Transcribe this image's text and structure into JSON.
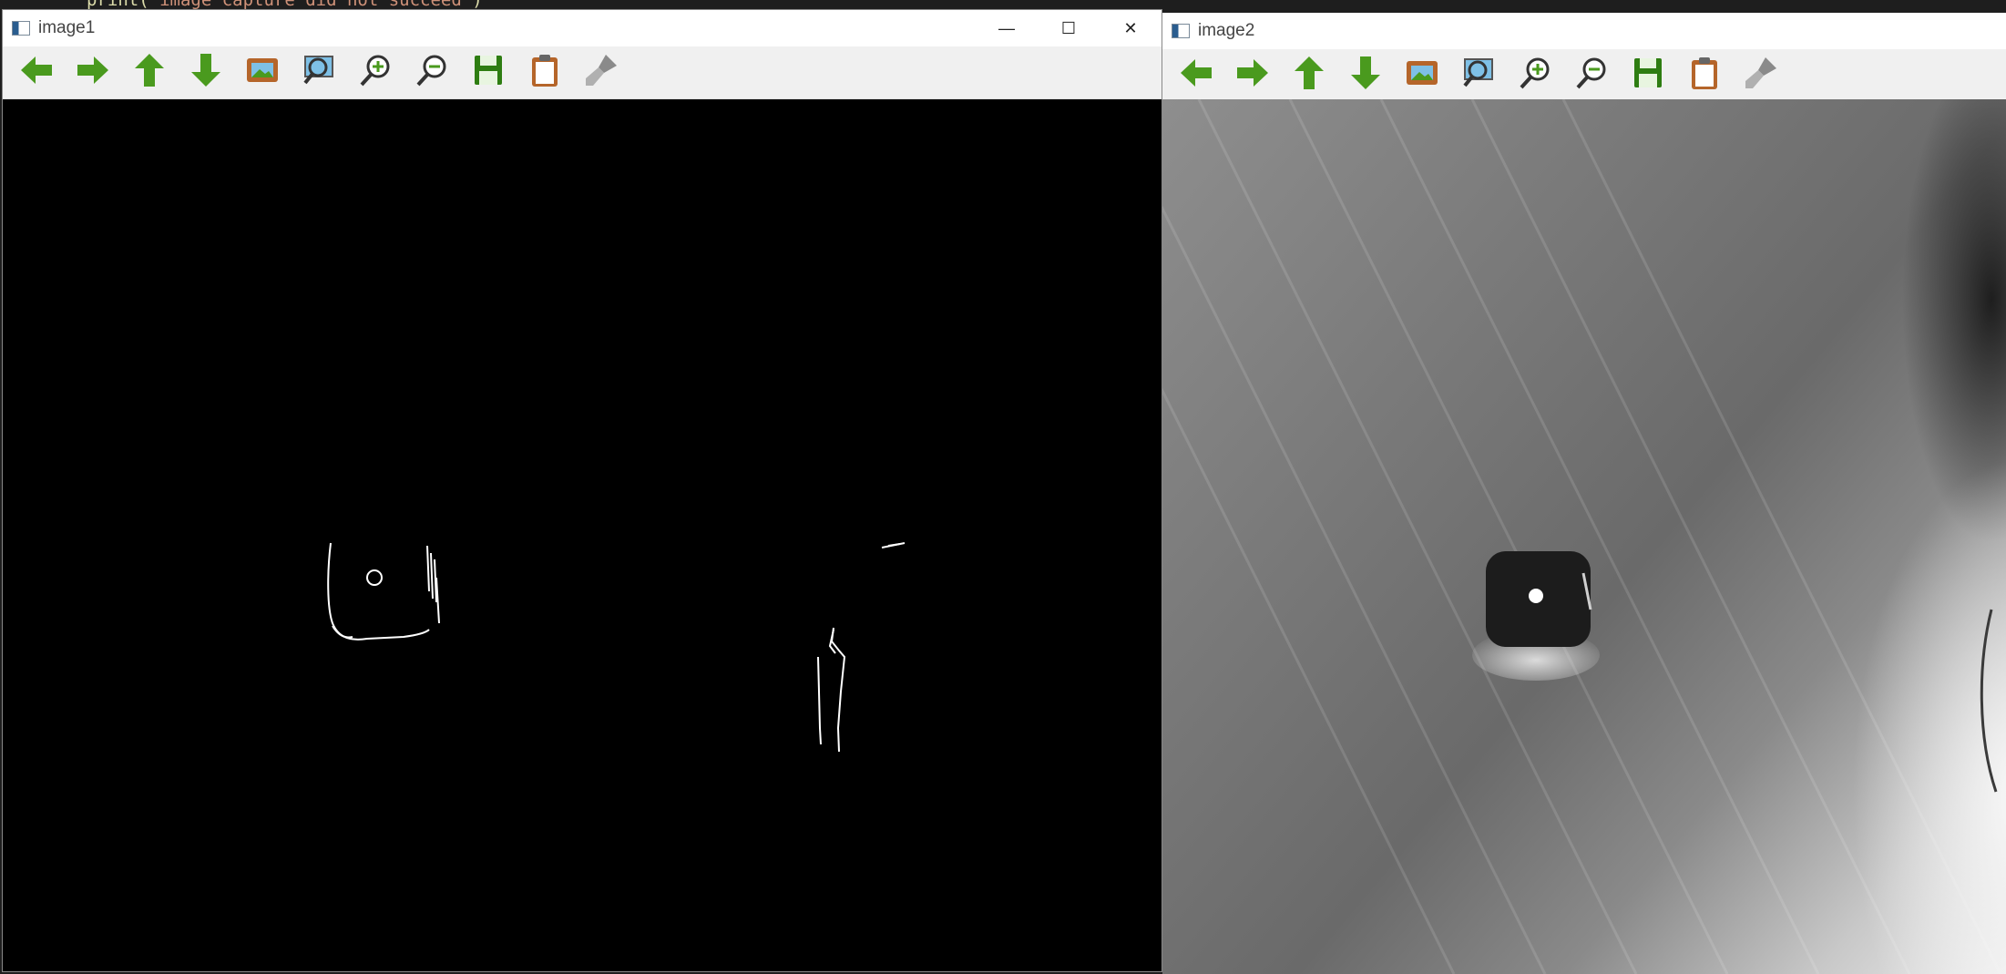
{
  "editor": {
    "code_fn": "print(",
    "code_str": "'image capture did not succeed'",
    "code_end": ")"
  },
  "windows": [
    {
      "title": "image1",
      "controls": {
        "minimize": "—",
        "maximize": "☐",
        "close": "✕"
      }
    },
    {
      "title": "image2"
    }
  ],
  "toolbar": {
    "buttons": [
      {
        "name": "pan-left",
        "icon": "arrow-left-icon"
      },
      {
        "name": "pan-right",
        "icon": "arrow-right-icon"
      },
      {
        "name": "pan-up",
        "icon": "arrow-up-icon"
      },
      {
        "name": "pan-down",
        "icon": "arrow-down-icon"
      },
      {
        "name": "zoom-original",
        "icon": "picture-icon"
      },
      {
        "name": "zoom-fit",
        "icon": "zoom-picture-icon"
      },
      {
        "name": "zoom-in",
        "icon": "zoom-in-icon"
      },
      {
        "name": "zoom-out",
        "icon": "zoom-out-icon"
      },
      {
        "name": "save",
        "icon": "floppy-disk-icon"
      },
      {
        "name": "copy-clipboard",
        "icon": "clipboard-icon"
      },
      {
        "name": "properties",
        "icon": "brush-icon"
      }
    ]
  },
  "colors": {
    "arrow_green": "#4a9a1e",
    "save_green": "#2e7d12",
    "frame_orange": "#b5652a",
    "tool_gray": "#8a8a8a",
    "edge_white": "#ffffff"
  }
}
